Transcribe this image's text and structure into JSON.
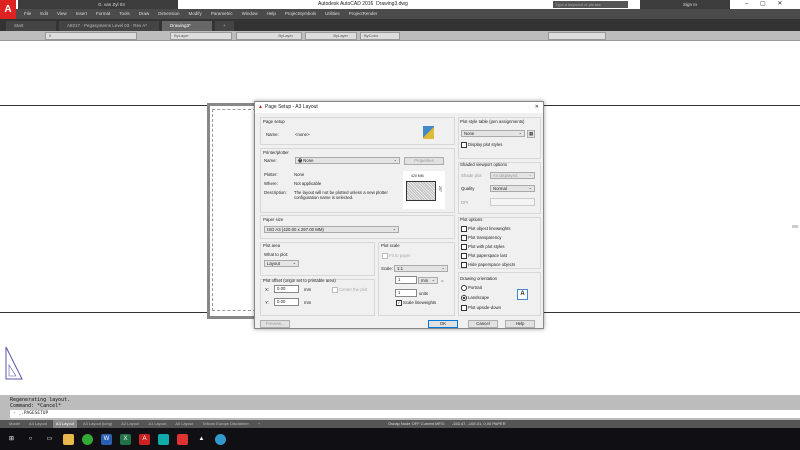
{
  "app": {
    "title": "Autodesk AutoCAD 2016",
    "file": "Drawing3.dwg",
    "user": "G. van Zyl 03",
    "search_placeholder": "Type a keyword or phrase",
    "sign_in": "Sign In"
  },
  "menu": [
    "File",
    "Edit",
    "View",
    "Insert",
    "Format",
    "Tools",
    "Draw",
    "Dimension",
    "Modify",
    "Parametric",
    "Window",
    "Help",
    "ProjectSymbols",
    "Utilities",
    "ProjectRender"
  ],
  "doc_tabs": [
    {
      "label": "Start"
    },
    {
      "label": "A8217 - Pegasystems Level 03 - Rev A*"
    },
    {
      "label": "Drawing3*"
    }
  ],
  "properties": {
    "layer": "0",
    "color": "ByLayer",
    "linetype": "ByLayer",
    "lineweight": "ByLayer",
    "plotstyle": "ByColor"
  },
  "command": {
    "history": [
      "Regenerating layout.",
      "Command: *Cancel*"
    ],
    "input": "- _.PAGESETUP"
  },
  "layout_tabs": [
    "Model",
    "A4 Layout",
    "A3 Layout",
    "A3 Layout (long)",
    "A2 Layout",
    "A1 Layout",
    "A0 Layout",
    "Telkom Europe Disclaimer"
  ],
  "active_layout": "A3 Layout",
  "status": {
    "snap": "Osnap Node OFF  Current MFG:",
    "coords": "-153.47, -105.01, 0.00",
    "space": "PAPER"
  },
  "dialog": {
    "title": "Page Setup - A3 Layout",
    "page_setup": {
      "label": "Page setup",
      "name_label": "Name:",
      "name": "<none>"
    },
    "printer": {
      "label": "Printer/plotter",
      "name_label": "Name:",
      "name": "None",
      "properties": "Properties",
      "plotter_label": "Plotter:",
      "plotter": "None",
      "where_label": "Where:",
      "where": "Not applicable",
      "desc_label": "Description:",
      "desc": "The layout will not be plotted unless a new plotter configuration name is selected.",
      "width": "420 MM",
      "height": "297"
    },
    "paper_size": {
      "label": "Paper size",
      "value": "ISO A3 (420.00 x 297.00 MM)"
    },
    "plot_area": {
      "label": "Plot area",
      "what_label": "What to plot:",
      "what": "Layout"
    },
    "plot_offset": {
      "label": "Plot offset (origin set to printable area)",
      "x_label": "X:",
      "x": "0.00",
      "y_label": "Y:",
      "y": "0.00",
      "unit": "mm",
      "center": "Center the plot"
    },
    "plot_scale": {
      "label": "Plot scale",
      "fit": "Fit to paper",
      "scale_label": "Scale:",
      "scale": "1:1",
      "value1": "1",
      "unit": "mm",
      "equals": "=",
      "value2": "1",
      "units": "units",
      "lineweights": "Scale lineweights"
    },
    "style_table": {
      "label": "Plot style table (pen assignments)",
      "value": "None",
      "display": "Display plot styles"
    },
    "shaded": {
      "label": "Shaded viewport options",
      "shade_label": "Shade plot",
      "shade": "As displayed",
      "quality_label": "Quality",
      "quality": "Normal",
      "dpi_label": "DPI"
    },
    "options": {
      "label": "Plot options",
      "items": [
        "Plot object lineweights",
        "Plot transparency",
        "Plot with plot styles",
        "Plot paperspace last",
        "Hide paperspace objects"
      ]
    },
    "orientation": {
      "label": "Drawing orientation",
      "portrait": "Portrait",
      "landscape": "Landscape",
      "upside": "Plot upside-down",
      "icon": "A"
    },
    "buttons": {
      "preview": "Preview...",
      "ok": "OK",
      "cancel": "Cancel",
      "help": "Help"
    }
  },
  "colors": {
    "accent": "#d22222",
    "dark": "#333333"
  }
}
